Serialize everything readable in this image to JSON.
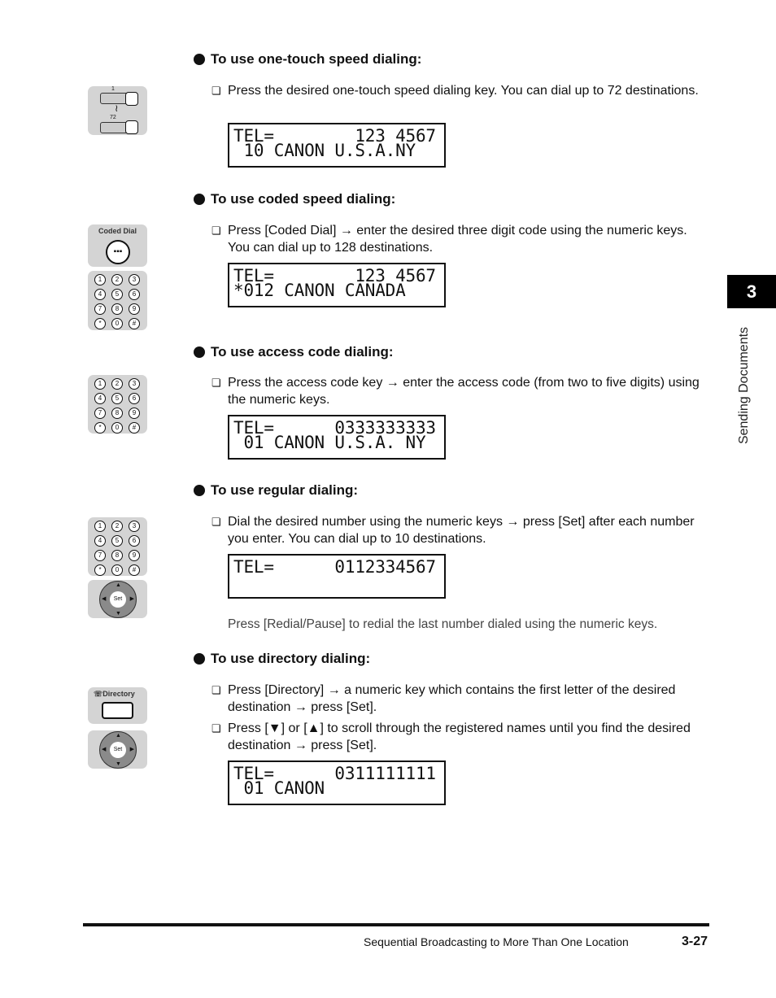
{
  "side_tab": {
    "chapter": "3",
    "section": "Sending Documents"
  },
  "keypad_keys": [
    "1",
    "2",
    "3",
    "4",
    "5",
    "6",
    "7",
    "8",
    "9",
    "*",
    "0",
    "#"
  ],
  "sections": [
    {
      "heading": "To use one-touch speed dialing:",
      "icon": {
        "top_label": "1",
        "bottom_label": "72"
      },
      "items": [
        "Press the desired one-touch speed dialing key. You can dial up to 72 destinations."
      ],
      "lcd": [
        "TEL=        123 4567",
        " 10 CANON U.S.A.NY"
      ]
    },
    {
      "heading": "To use coded speed dialing:",
      "icon": {
        "label": "Coded Dial"
      },
      "items": [
        "Press [Coded Dial] → enter the desired three digit code using the numeric keys. You can dial up to 128 destinations."
      ],
      "lcd": [
        "TEL=        123 4567",
        "*012 CANON CANADA"
      ]
    },
    {
      "heading": "To use access code dialing:",
      "items": [
        "Press the access code key → enter the access code (from two to five digits) using the numeric keys."
      ],
      "lcd": [
        "TEL=      0333333333",
        " 01 CANON U.S.A. NY"
      ]
    },
    {
      "heading": "To use regular dialing:",
      "items": [
        "Dial the desired number using the numeric keys → press [Set] after each number you enter. You can dial up to 10 destinations."
      ],
      "lcd": [
        "TEL=      0112334567",
        ""
      ],
      "note": "Press [Redial/Pause] to redial the last number dialed using the numeric keys."
    },
    {
      "heading": "To use directory dialing:",
      "icon": {
        "label": "Directory"
      },
      "items": [
        "Press [Directory] → a numeric key which contains the first letter of the desired destination → press [Set].",
        "Press [▼] or [▲] to scroll through the registered names until you find the desired destination → press [Set]."
      ],
      "lcd": [
        "TEL=      0311111111",
        " 01 CANON"
      ]
    }
  ],
  "set_label": "Set",
  "checkbox_glyph": "❏",
  "footer": {
    "title": "Sequential Broadcasting to More Than One Location",
    "page": "3-27"
  }
}
